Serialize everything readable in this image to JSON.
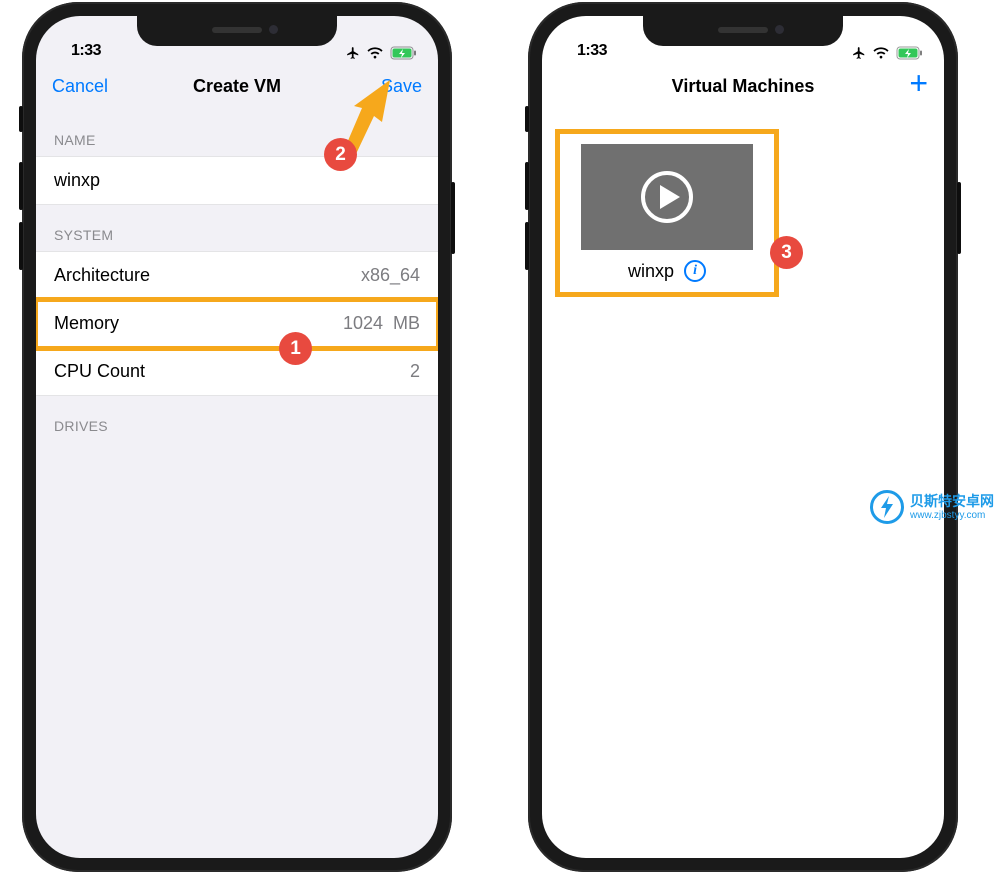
{
  "status": {
    "time": "1:33"
  },
  "left_screen": {
    "nav": {
      "cancel": "Cancel",
      "title": "Create VM",
      "save": "Save"
    },
    "sections": {
      "name_header": "NAME",
      "name_value": "winxp",
      "system_header": "SYSTEM",
      "architecture_label": "Architecture",
      "architecture_value": "x86_64",
      "memory_label": "Memory",
      "memory_value": "1024",
      "memory_unit": "MB",
      "cpu_label": "CPU Count",
      "cpu_value": "2",
      "drives_header": "DRIVES"
    }
  },
  "right_screen": {
    "nav": {
      "title": "Virtual Machines"
    },
    "vm": {
      "name": "winxp"
    }
  },
  "annotations": {
    "badge1": "1",
    "badge2": "2",
    "badge3": "3",
    "arrow_color": "#f6a81c",
    "highlight_color": "#f6a81c"
  },
  "watermark": {
    "title": "贝斯特安卓网",
    "url": "www.zjbstyy.com"
  },
  "colors": {
    "ios_blue": "#007aff",
    "badge_red": "#e84a3f"
  }
}
